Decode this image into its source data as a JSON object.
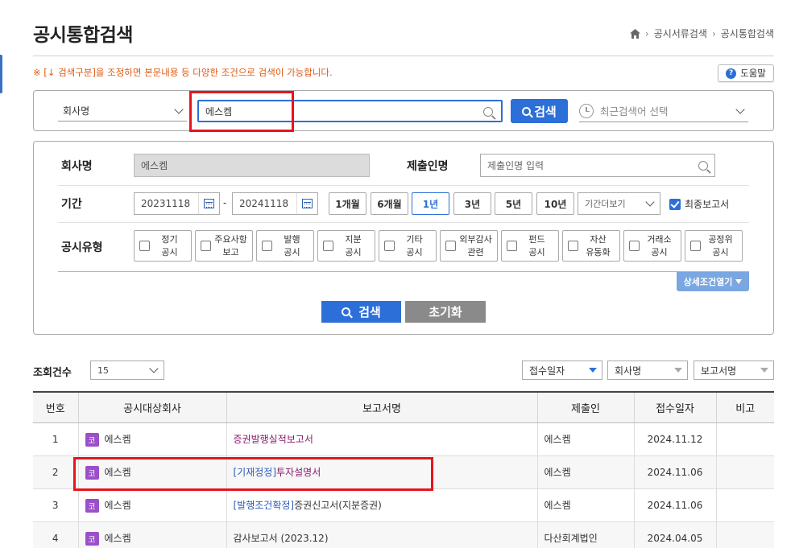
{
  "page": {
    "title": "공시통합검색",
    "breadcrumb": [
      "공시서류검색",
      "공시통합검색"
    ]
  },
  "notice": "※ [↓ 검색구분]을 조정하면 본문내용 등 다양한 조건으로 검색이 가능합니다.",
  "help_label": "도움말",
  "search": {
    "type_value": "회사명",
    "query_value": "에스켐",
    "button_label": "검색",
    "recent_placeholder": "최근검색어 선택"
  },
  "conditions": {
    "company_label": "회사명",
    "company_value": "에스켐",
    "submitter_label": "제출인명",
    "submitter_placeholder": "제출인명 입력",
    "period_label": "기간",
    "date_from": "20231118",
    "date_sep": "-",
    "date_to": "20241118",
    "period_buttons": [
      "1개월",
      "6개월",
      "1년",
      "3년",
      "5년",
      "10년"
    ],
    "active_period": "1년",
    "more_period": "기간더보기",
    "final_report_label": "최종보고서",
    "final_report_checked": true,
    "type_label": "공시유형",
    "types": [
      [
        "정기",
        "공시"
      ],
      [
        "주요사항",
        "보고"
      ],
      [
        "발행",
        "공시"
      ],
      [
        "지분",
        "공시"
      ],
      [
        "기타",
        "공시"
      ],
      [
        "외부감사",
        "관련"
      ],
      [
        "펀드",
        "공시"
      ],
      [
        "자산",
        "유동화"
      ],
      [
        "거래소",
        "공시"
      ],
      [
        "공정위",
        "공시"
      ]
    ],
    "detail_toggle": "상세조건열기",
    "search_label": "검색",
    "reset_label": "초기화"
  },
  "results": {
    "count_label": "조회건수",
    "count_value": "15",
    "sort": [
      {
        "label": "접수일자",
        "active": true
      },
      {
        "label": "회사명",
        "active": false
      },
      {
        "label": "보고서명",
        "active": false
      }
    ],
    "columns": [
      "번호",
      "공시대상회사",
      "보고서명",
      "제출인",
      "접수일자",
      "비고"
    ],
    "badge": "코",
    "rows": [
      {
        "no": "1",
        "company": "에스켐",
        "report_prefix": "",
        "report": "증권발행실적보고서",
        "submitter": "에스켐",
        "date": "2024.11.12",
        "note": ""
      },
      {
        "no": "2",
        "company": "에스켐",
        "report_prefix": "[기재정정]",
        "report": "투자설명서",
        "submitter": "에스켐",
        "date": "2024.11.06",
        "note": ""
      },
      {
        "no": "3",
        "company": "에스켐",
        "report_prefix": "[발행조건확정]",
        "report": "증권신고서(지분증권)",
        "submitter": "에스켐",
        "date": "2024.11.06",
        "note": ""
      },
      {
        "no": "4",
        "company": "에스켐",
        "report_prefix": "",
        "report": "감사보고서 (2023.12)",
        "submitter": "다산회계법인",
        "date": "2024.04.05",
        "note": ""
      }
    ]
  }
}
